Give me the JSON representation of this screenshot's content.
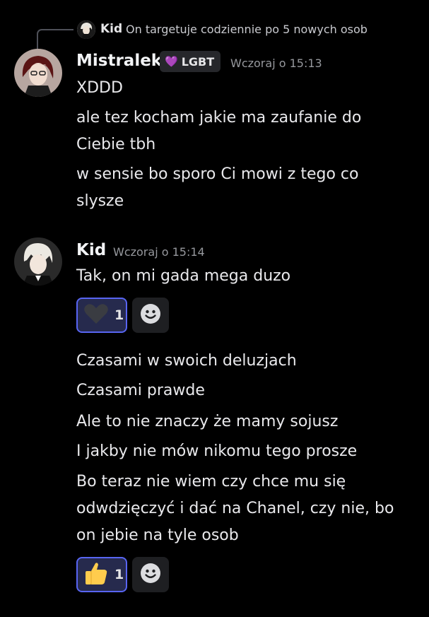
{
  "reply": {
    "author": "Kid",
    "text": "On targetuje codziennie po 5 nowych osob"
  },
  "messages": [
    {
      "author": "Mistralek",
      "role_tag": "LGBT",
      "role_icon": "heart-icon",
      "timestamp": "Wczoraj o 15:13",
      "lines": [
        "XDDD",
        "ale tez kocham jakie ma zaufanie do",
        "Ciebie tbh",
        "w sensie bo sporo Ci mowi z tego co",
        "slysze"
      ]
    },
    {
      "author": "Kid",
      "timestamp": "Wczoraj o 15:14",
      "lines": [
        "Tak, on mi gada mega duzo"
      ],
      "reaction": {
        "emoji": "black-heart-icon",
        "count": "1"
      }
    }
  ],
  "followups": [
    {
      "lines": [
        "Czasami w swoich deluzjach",
        "Czasami prawde",
        "Ale to nie znaczy że mamy sojusz",
        "I jakby nie mów nikomu tego prosze",
        "Bo teraz nie wiem czy chce mu się",
        "odwdzięczyć i dać na Chanel, czy nie, bo",
        "on jebie na tyle osob"
      ],
      "reaction": {
        "emoji": "thumbs-up-icon",
        "count": "1"
      }
    }
  ],
  "colors": {
    "background": "#000000",
    "accent": "#5865f2",
    "reaction_bg": "#262a4d",
    "role_heart": "#e08af2",
    "timestamp": "#96989d"
  }
}
